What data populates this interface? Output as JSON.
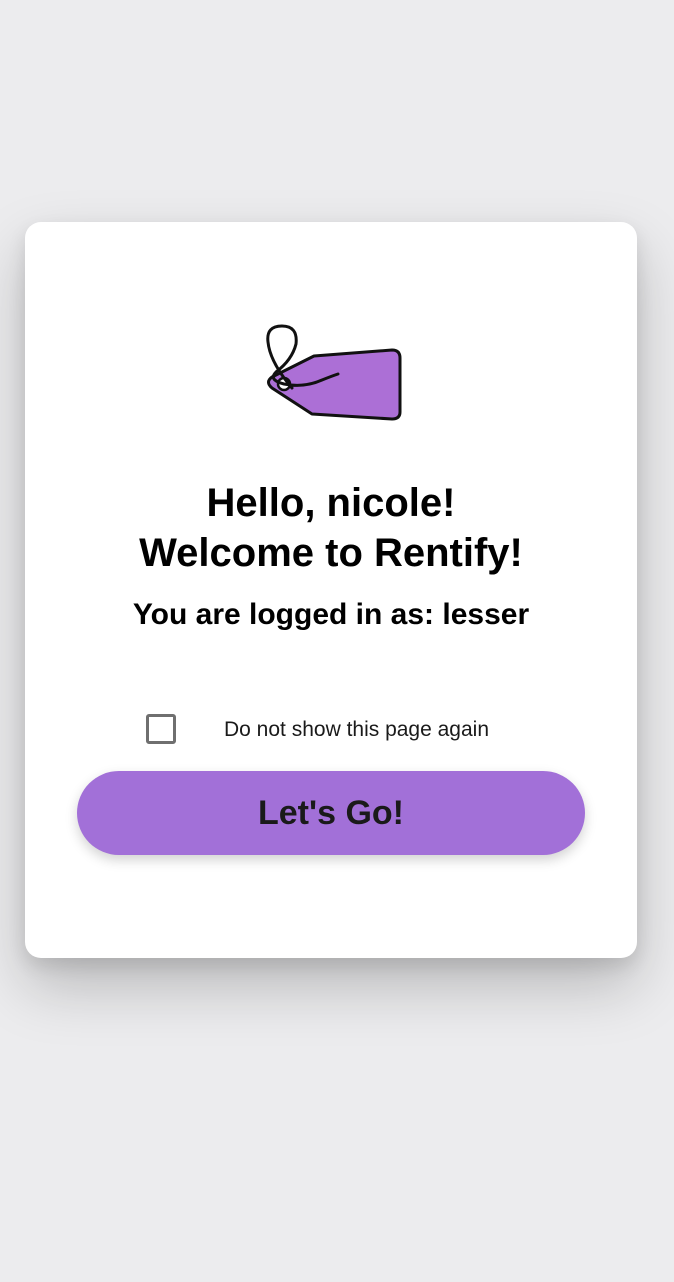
{
  "background_color": "#ececee",
  "card": {
    "logo_icon": "price-tag-icon",
    "accent_color": "#a270d8",
    "greeting_line1": "Hello, nicole!",
    "greeting_line2": "Welcome to Rentify!",
    "logged_in_text": "You are logged in as: lesser",
    "dont_show_checkbox": {
      "label": "Do not show this page again",
      "checked": false
    },
    "go_button_label": "Let's Go!"
  }
}
